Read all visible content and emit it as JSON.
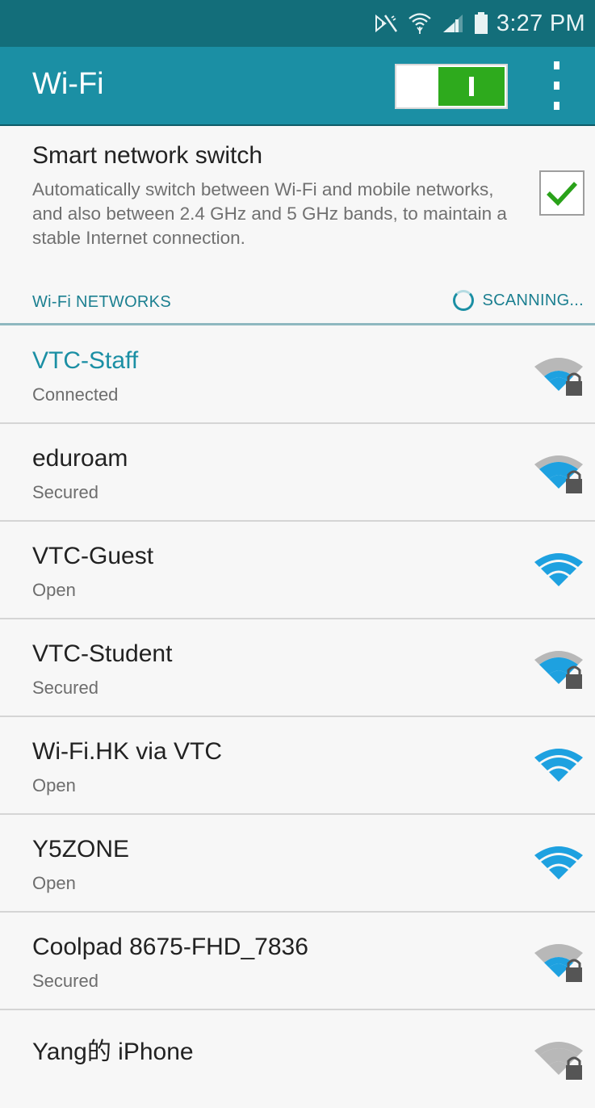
{
  "status_bar": {
    "time": "3:27 PM",
    "icons": [
      "mute-vibrate-icon",
      "wifi-transfer-icon",
      "cellular-signal-icon",
      "battery-icon"
    ]
  },
  "app_bar": {
    "title": "Wi-Fi",
    "wifi_enabled": true,
    "overflow_icon": "more-vert-icon"
  },
  "smart_switch": {
    "title": "Smart network switch",
    "description": "Automatically switch between Wi-Fi and mobile networks, and also between 2.4 GHz and 5 GHz bands, to maintain a stable Internet connection.",
    "checked": true
  },
  "section": {
    "title": "Wi-Fi NETWORKS",
    "scanning_label": "SCANNING..."
  },
  "networks": [
    {
      "name": "VTC-Staff",
      "status": "Connected",
      "secured": true,
      "connected": true
    },
    {
      "name": "eduroam",
      "status": "Secured",
      "secured": true,
      "connected": false
    },
    {
      "name": "VTC-Guest",
      "status": "Open",
      "secured": false,
      "connected": false
    },
    {
      "name": "VTC-Student",
      "status": "Secured",
      "secured": true,
      "connected": false
    },
    {
      "name": "Wi-Fi.HK via VTC",
      "status": "Open",
      "secured": false,
      "connected": false
    },
    {
      "name": "Y5ZONE",
      "status": "Open",
      "secured": false,
      "connected": false
    },
    {
      "name": "Coolpad 8675-FHD_7836",
      "status": "Secured",
      "secured": true,
      "connected": false
    },
    {
      "name": "Yang的 iPhone",
      "status": "",
      "secured": true,
      "connected": false
    }
  ],
  "colors": {
    "status_bar": "#136e7a",
    "app_bar": "#1b8fa4",
    "toggle_on": "#2eaa1d",
    "accent": "#1b8fa4",
    "signal_strong": "#1ea1e0",
    "signal_weak": "#b8b8b8"
  }
}
